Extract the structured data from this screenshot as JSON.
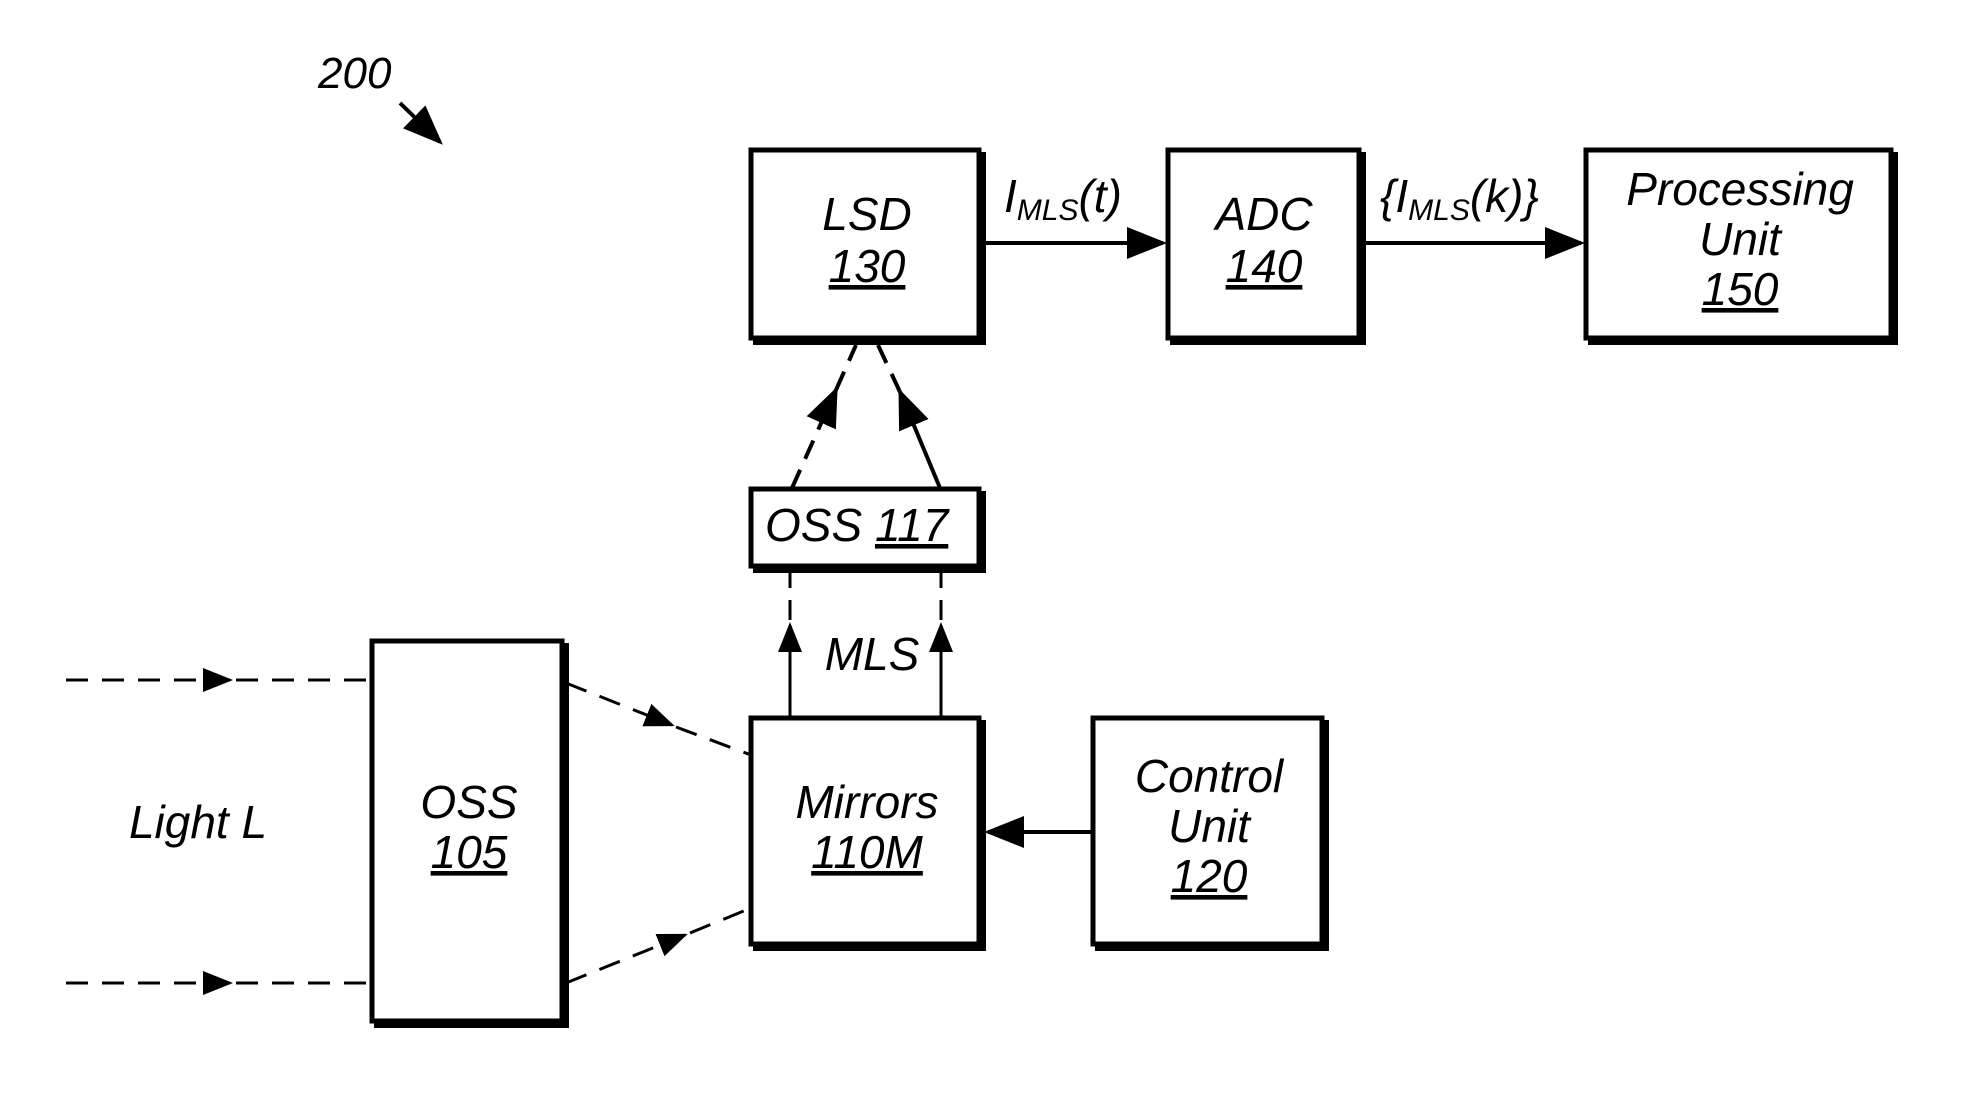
{
  "figure": {
    "ref_number": "200",
    "blocks": {
      "lsd": {
        "name": "LSD",
        "num": "130"
      },
      "adc": {
        "name": "ADC",
        "num": "140"
      },
      "pu": {
        "line1": "Processing",
        "line2": "Unit",
        "num": "150"
      },
      "oss117": {
        "name": "OSS",
        "num": "117"
      },
      "mirrors": {
        "name": "Mirrors",
        "num": "110M"
      },
      "control": {
        "line1": "Control",
        "line2": "Unit",
        "num": "120"
      },
      "oss105": {
        "name": "OSS",
        "num": "105"
      }
    },
    "signals": {
      "imls_t": {
        "base": "I",
        "sub": "MLS",
        "arg": "(t)"
      },
      "imls_k": {
        "open": "{",
        "base": "I",
        "sub": "MLS",
        "arg": "(k)}"
      },
      "mls": "MLS",
      "light": "Light L"
    }
  }
}
